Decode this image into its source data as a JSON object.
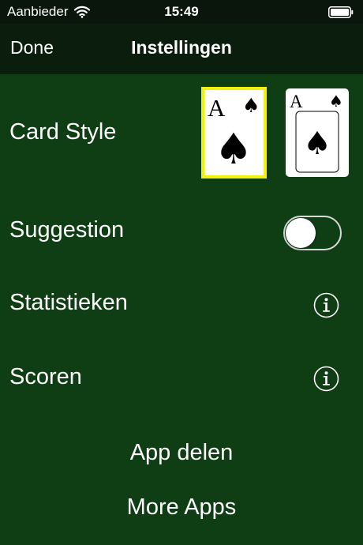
{
  "status_bar": {
    "carrier": "Aanbieder",
    "time": "15:49",
    "wifi_icon": "wifi-icon",
    "battery_icon": "battery-icon"
  },
  "nav": {
    "done_label": "Done",
    "title": "Instellingen"
  },
  "settings": {
    "card_style_label": "Card Style",
    "card_styles": [
      {
        "rank": "A",
        "suit": "♠",
        "selected": true
      },
      {
        "rank": "A",
        "suit": "♠",
        "selected": false
      }
    ],
    "suggestion_label": "Suggestion",
    "suggestion_enabled": false,
    "statistics_label": "Statistieken",
    "scoring_label": "Scoren",
    "info_icon": "info-icon"
  },
  "links": {
    "share_label": "App delen",
    "more_apps_label": "More Apps"
  },
  "colors": {
    "background": "#0f3d14",
    "nav_background": "#0b1d0d",
    "selection_border": "#f2f20e"
  }
}
